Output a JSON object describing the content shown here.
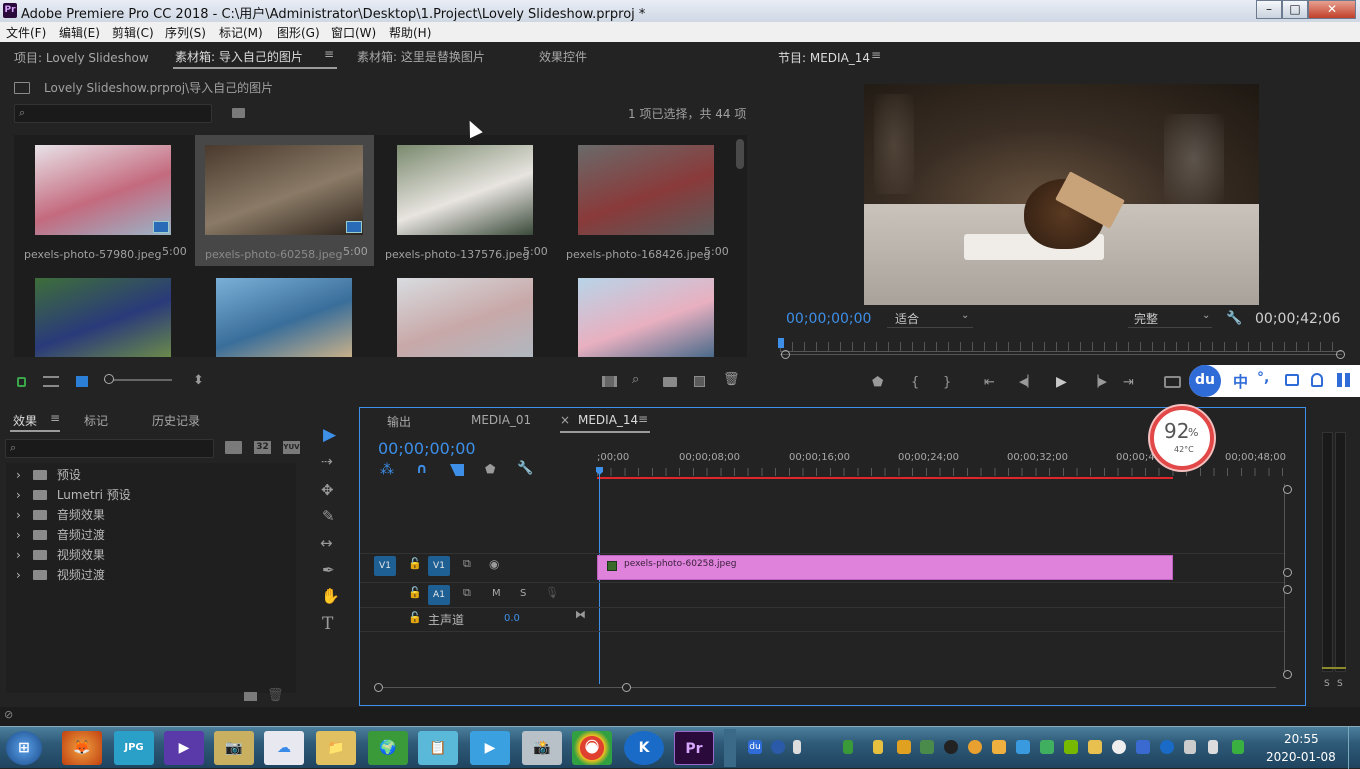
{
  "window": {
    "title": "Adobe Premiere Pro CC 2018 - C:\\用户\\Administrator\\Desktop\\1.Project\\Lovely Slideshow.prproj *",
    "app_badge": "Pr",
    "minimize": "–",
    "maximize": "□",
    "close": "✕"
  },
  "menu": [
    "文件(F)",
    "编辑(E)",
    "剪辑(C)",
    "序列(S)",
    "标记(M)",
    "图形(G)",
    "窗口(W)",
    "帮助(H)"
  ],
  "project_panel": {
    "tabs": [
      "项目: Lovely Slideshow",
      "素材箱: 导入自己的图片",
      "素材箱: 这里是替换图片",
      "效果控件"
    ],
    "menu_icon": "≡",
    "path": "Lovely Slideshow.prproj\\导入自己的图片",
    "selection_info": "1 项已选择，共 44 项",
    "items": [
      {
        "name": "pexels-photo-57980.jpeg",
        "duration": "5:00",
        "colors": [
          "#e8e2e8",
          "#c46a7e",
          "#9ab4c8"
        ],
        "selected": false
      },
      {
        "name": "pexels-photo-60258.jpeg",
        "duration": "5:00",
        "colors": [
          "#4a3a2e",
          "#8a7a66",
          "#2e241c"
        ],
        "selected": true
      },
      {
        "name": "pexels-photo-137576.jpeg",
        "duration": "5:00",
        "colors": [
          "#7a8a6e",
          "#e8e4e0",
          "#3a4a3a"
        ],
        "selected": false
      },
      {
        "name": "pexels-photo-168426.jpeg",
        "duration": "5:00",
        "colors": [
          "#6a6a6a",
          "#8a3a3a",
          "#5a5a5a"
        ],
        "selected": false
      },
      {
        "name": "",
        "duration": "",
        "colors": [
          "#3e6e3a",
          "#2a3a7a",
          "#6a8a4a"
        ],
        "selected": false
      },
      {
        "name": "",
        "duration": "",
        "colors": [
          "#7ab0d8",
          "#3a6e9a",
          "#c8b08a"
        ],
        "selected": false
      },
      {
        "name": "",
        "duration": "",
        "colors": [
          "#d8dce0",
          "#c8a8a8",
          "#b0b8c0"
        ],
        "selected": false
      },
      {
        "name": "",
        "duration": "",
        "colors": [
          "#b8d4e8",
          "#e8b0c0",
          "#4a6a8a"
        ],
        "selected": false
      }
    ]
  },
  "program_monitor": {
    "title": "节目: MEDIA_14",
    "menu_icon": "≡",
    "timecode": "00;00;00;00",
    "fit": "适合",
    "quality": "完整",
    "duration": "00;00;42;06",
    "transport": [
      "⬟",
      "{",
      "}",
      "⇤",
      "◀▏",
      "▶",
      "▕▶",
      "⇥"
    ]
  },
  "effects_panel": {
    "tabs": [
      "效果",
      "标记",
      "历史记录"
    ],
    "menu_icon": "≡",
    "folders": [
      "预设",
      "Lumetri 预设",
      "音频效果",
      "音频过渡",
      "视频效果",
      "视频过渡"
    ],
    "filter_labels": [
      "32",
      "YUV"
    ]
  },
  "tools": [
    "▶",
    "⇢",
    "✥",
    "✎",
    "↔",
    "✒",
    "✋",
    "T"
  ],
  "timeline": {
    "tabs": [
      "输出",
      "MEDIA_01",
      "MEDIA_14"
    ],
    "close": "×",
    "menu_icon": "≡",
    "timecode": "00;00;00;00",
    "ruler": [
      ";00;00",
      "00;00;08;00",
      "00;00;16;00",
      "00;00;24;00",
      "00;00;32;00",
      "00;00;40;00",
      "00;00;48;00"
    ],
    "tracks": {
      "v1_left": "V1",
      "v1_right": "V1",
      "a1": "A1",
      "m": "M",
      "s": "S",
      "master_label": "主声道",
      "master_value": "0.0"
    },
    "clip": {
      "name": "pexels-photo-60258.jpeg",
      "color": "#de82dc",
      "start_seconds": 0,
      "end_seconds": 42.2
    },
    "duration_seconds": 50
  },
  "perf_widget": {
    "value": "92",
    "unit": "%",
    "temp": "42°C"
  },
  "ime_toolbar": {
    "logo": "du",
    "lang": "中",
    "punct": "°,"
  },
  "audio_meter": {
    "s1": "S",
    "s2": "S"
  },
  "taskbar": {
    "apps": [
      "⊞",
      "🦊",
      "JPG",
      "▶",
      "📷",
      "☁",
      "📁",
      "🌍",
      "📋",
      "▶",
      "📸",
      "⦿",
      "K",
      "Pr"
    ],
    "time": "20:55",
    "date": "2020-01-08",
    "tray_du": "du"
  }
}
